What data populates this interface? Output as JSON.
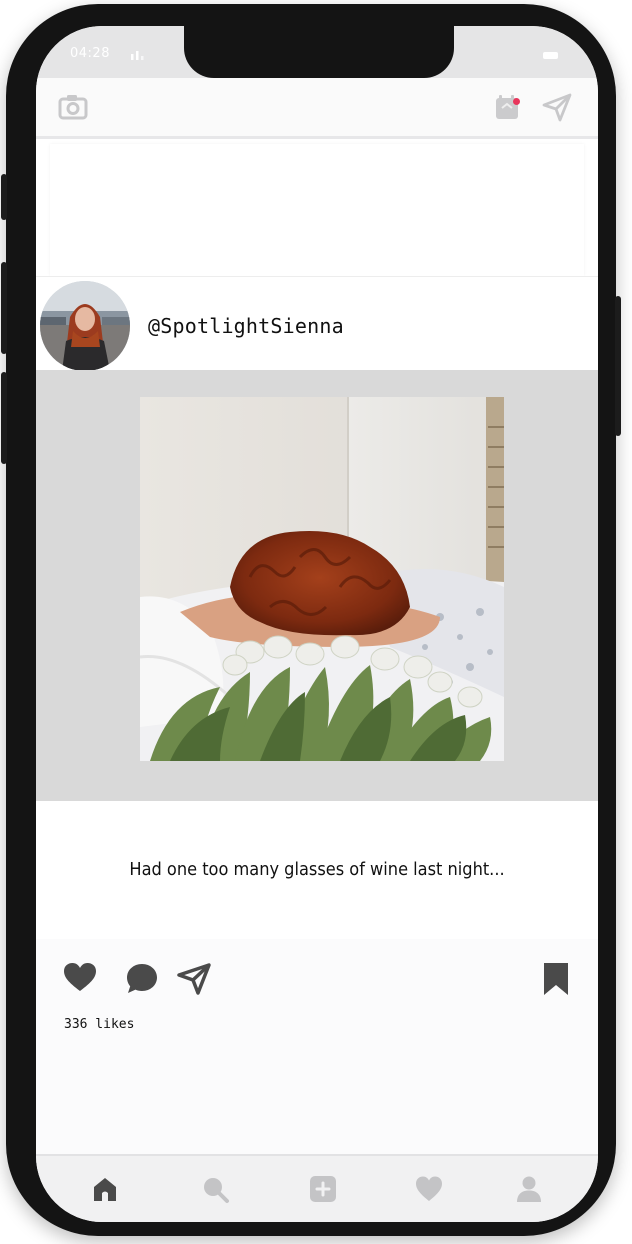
{
  "status_bar": {
    "time": "04:28"
  },
  "header": {
    "left_icon": "camera-icon",
    "right_icons": [
      "activity-icon",
      "direct-message-icon"
    ],
    "notification_dot_color": "#e8355b"
  },
  "post": {
    "username": "@SpotlightSienna",
    "caption": "Had one too many glasses of wine last night...",
    "likes": "336 likes",
    "actions": [
      "heart-icon",
      "comment-icon",
      "share-icon",
      "bookmark-icon"
    ]
  },
  "bottom_nav": {
    "items": [
      "home-icon",
      "search-icon",
      "add-post-icon",
      "heart-icon",
      "profile-icon"
    ],
    "active": "home-icon"
  },
  "colors": {
    "frame": "#141414",
    "active_icon": "#4a4a4a",
    "inactive_icon": "#c4c4c6",
    "post_background": "#d9d9d9"
  }
}
